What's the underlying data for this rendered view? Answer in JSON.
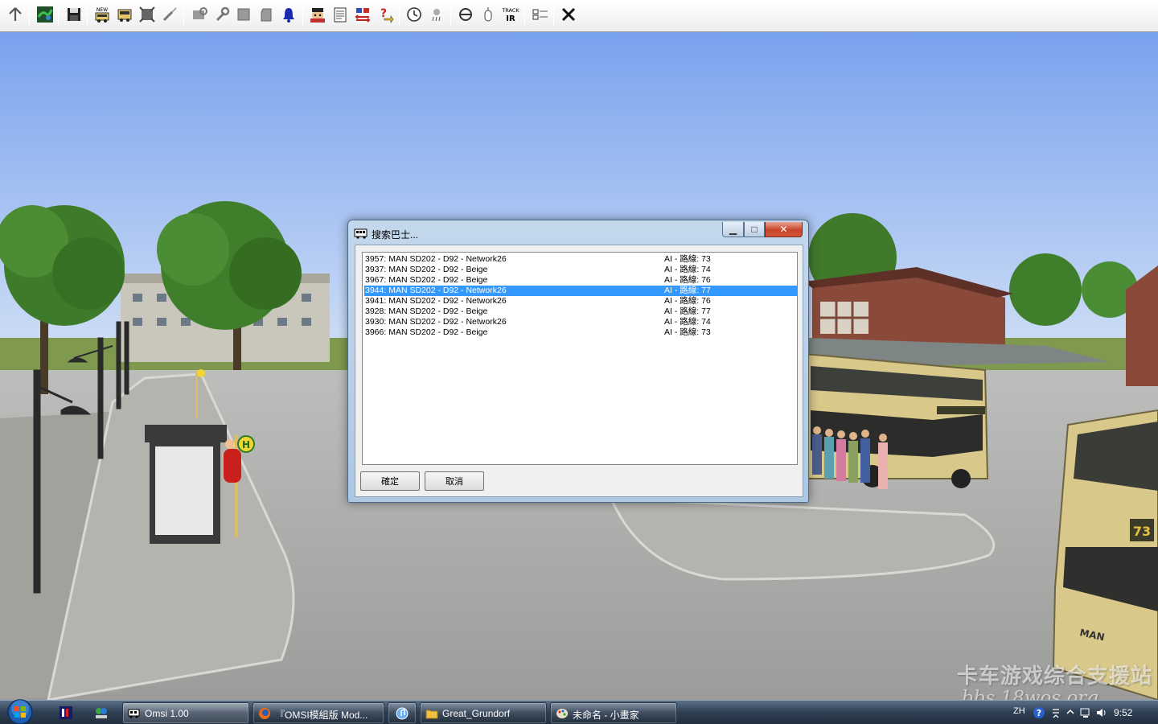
{
  "toolbar": {
    "icons": [
      "up-arrow-icon",
      "map-icon",
      "save-icon",
      "new-bus-icon",
      "bus-icon",
      "frame-icon",
      "paint-icon",
      "bus-settings-icon",
      "wrench-icon",
      "chip-icon",
      "door-icon",
      "bell-icon",
      "driver-icon",
      "timetable-icon",
      "swap-icon",
      "question-icon",
      "clock-icon",
      "weather-icon",
      "steering-icon",
      "mouse-icon",
      "trackir-icon",
      "time-settings-icon",
      "close-icon"
    ],
    "new_label": "NEW",
    "trackir_label_top": "TRACK",
    "trackir_label_bottom": "IR"
  },
  "dialog": {
    "title": "搜索巴士...",
    "items": [
      {
        "bus": "3957: MAN SD202 - D92 - Network26",
        "route": "AI - 路線: 73",
        "selected": false
      },
      {
        "bus": "3937: MAN SD202 - D92 - Beige",
        "route": "AI - 路線: 74",
        "selected": false
      },
      {
        "bus": "3967: MAN SD202 - D92 - Beige",
        "route": "AI - 路線: 76",
        "selected": false
      },
      {
        "bus": "3944: MAN SD202 - D92 - Network26",
        "route": "AI - 路線: 77",
        "selected": true
      },
      {
        "bus": "3941: MAN SD202 - D92 - Network26",
        "route": "AI - 路線: 76",
        "selected": false
      },
      {
        "bus": "3928: MAN SD202 - D92 - Beige",
        "route": "AI - 路線: 77",
        "selected": false
      },
      {
        "bus": "3930: MAN SD202 - D92 - Network26",
        "route": "AI - 路線: 74",
        "selected": false
      },
      {
        "bus": "3966: MAN SD202 - D92 - Beige",
        "route": "AI - 路線: 73",
        "selected": false
      }
    ],
    "ok_label": "確定",
    "cancel_label": "取消",
    "minimize_symbol": "▁",
    "maximize_symbol": "□",
    "close_symbol": "✕"
  },
  "scene": {
    "bus_route_sign": "73",
    "bus_brand": "MAN",
    "stop_sign": "H"
  },
  "taskbar": {
    "buttons": [
      {
        "label": "Omsi 1.00",
        "icon": "omsi-icon",
        "active": true
      },
      {
        "label": "『OMSI模組版 Mod...",
        "icon": "firefox-icon",
        "active": false
      },
      {
        "label": "",
        "icon": "itunes-icon",
        "active": false
      },
      {
        "label": "Great_Grundorf",
        "icon": "folder-icon",
        "active": false
      },
      {
        "label": "未命名 - 小畫家",
        "icon": "paint-app-icon",
        "active": false
      }
    ],
    "tray_lang": "ZH",
    "clock": "9:52"
  },
  "watermark": {
    "line1": "卡车游戏综合支援站",
    "line2": "bbs.18wos.org"
  },
  "colors": {
    "selection": "#3399ff",
    "sky_top": "#7ea6ee",
    "bus_beige": "#d8c88a",
    "close_red": "#c8442a"
  }
}
